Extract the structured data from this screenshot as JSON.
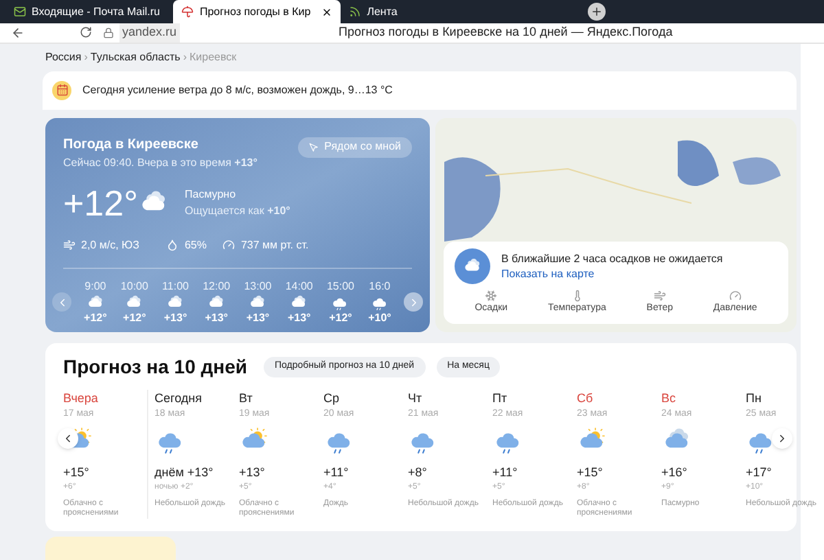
{
  "browser": {
    "tabs": [
      {
        "title": "Входящие - Почта Mail.ru",
        "kind": "mail",
        "selected": false
      },
      {
        "title": "Прогноз погоды в Кир",
        "kind": "umbrella",
        "selected": true
      },
      {
        "title": "Лента",
        "kind": "feed",
        "selected": false
      }
    ],
    "address": "yandex.ru",
    "page_title": "Прогноз погоды в Киреевске на 10 дней — Яндекс.Погода"
  },
  "breadcrumb_separator": "›",
  "breadcrumbs": [
    {
      "label": "Россия",
      "current": false
    },
    {
      "label": "Тульская область",
      "current": false
    },
    {
      "label": "Киреевск",
      "current": true
    }
  ],
  "alert": "Сегодня усиление ветра до 8 м/с, возможен дождь, 9…13 °C",
  "now": {
    "title": "Погода в Киреевске",
    "subtitle": "Сейчас 09:40. Вчера в это время **+13°**",
    "nearby_button": "Рядом со мной",
    "temp": "+12°",
    "condition": "Пасмурно",
    "feels": "Ощущается как **+10°**",
    "wind": "2,0 м/с, ЮЗ",
    "humidity": "65%",
    "pressure": "737 мм рт. ст.",
    "hours": [
      {
        "time": "9:00",
        "kind": "cloudy",
        "temp": "+12°"
      },
      {
        "time": "10:00",
        "kind": "cloudy",
        "temp": "+12°"
      },
      {
        "time": "11:00",
        "kind": "cloudy",
        "temp": "+13°"
      },
      {
        "time": "12:00",
        "kind": "cloudy",
        "temp": "+13°"
      },
      {
        "time": "13:00",
        "kind": "cloudy",
        "temp": "+13°"
      },
      {
        "time": "14:00",
        "kind": "cloudy",
        "temp": "+13°"
      },
      {
        "time": "15:00",
        "kind": "rain",
        "temp": "+12°"
      },
      {
        "time": "16:0",
        "kind": "rain",
        "temp": "+10°"
      }
    ]
  },
  "map": {
    "message": "В ближайшие 2 часа осадков не ожидается",
    "link": "Показать на карте",
    "layers": [
      {
        "label": "Осадки",
        "kind": "precipitation"
      },
      {
        "label": "Температура",
        "kind": "temperature"
      },
      {
        "label": "Ветер",
        "kind": "wind"
      },
      {
        "label": "Давление",
        "kind": "pressure"
      }
    ]
  },
  "forecast": {
    "title": "Прогноз на 10 дней",
    "buttons": [
      "Подробный прогноз на 10 дней",
      "На месяц"
    ],
    "days": [
      {
        "name": "Вчера",
        "date": "17 мая",
        "weekend": true,
        "kind": "partly_cloudy",
        "day": "+15°",
        "night": "+6°",
        "condition": "Облачно с прояснениями"
      },
      {
        "name": "Сегодня",
        "date": "18 мая",
        "weekend": false,
        "kind": "rain",
        "day": "днём +13°",
        "night": "ночью +2°",
        "condition": "Небольшой дождь"
      },
      {
        "name": "Вт",
        "date": "19 мая",
        "weekend": false,
        "kind": "partly_cloudy",
        "day": "+13°",
        "night": "+5°",
        "condition": "Облачно с прояснениями"
      },
      {
        "name": "Ср",
        "date": "20 мая",
        "weekend": false,
        "kind": "rain",
        "day": "+11°",
        "night": "+4°",
        "condition": "Дождь"
      },
      {
        "name": "Чт",
        "date": "21 мая",
        "weekend": false,
        "kind": "rain",
        "day": "+8°",
        "night": "+5°",
        "condition": "Небольшой дождь"
      },
      {
        "name": "Пт",
        "date": "22 мая",
        "weekend": false,
        "kind": "rain",
        "day": "+11°",
        "night": "+5°",
        "condition": "Небольшой дождь"
      },
      {
        "name": "Сб",
        "date": "23 мая",
        "weekend": true,
        "kind": "partly_cloudy",
        "day": "+15°",
        "night": "+8°",
        "condition": "Облачно с прояснениями"
      },
      {
        "name": "Вс",
        "date": "24 мая",
        "weekend": true,
        "kind": "cloudy",
        "day": "+16°",
        "night": "+9°",
        "condition": "Пасмурно"
      },
      {
        "name": "Пн",
        "date": "25 мая",
        "weekend": false,
        "kind": "rain",
        "day": "+17°",
        "night": "+10°",
        "condition": "Небольшой дождь"
      }
    ]
  }
}
